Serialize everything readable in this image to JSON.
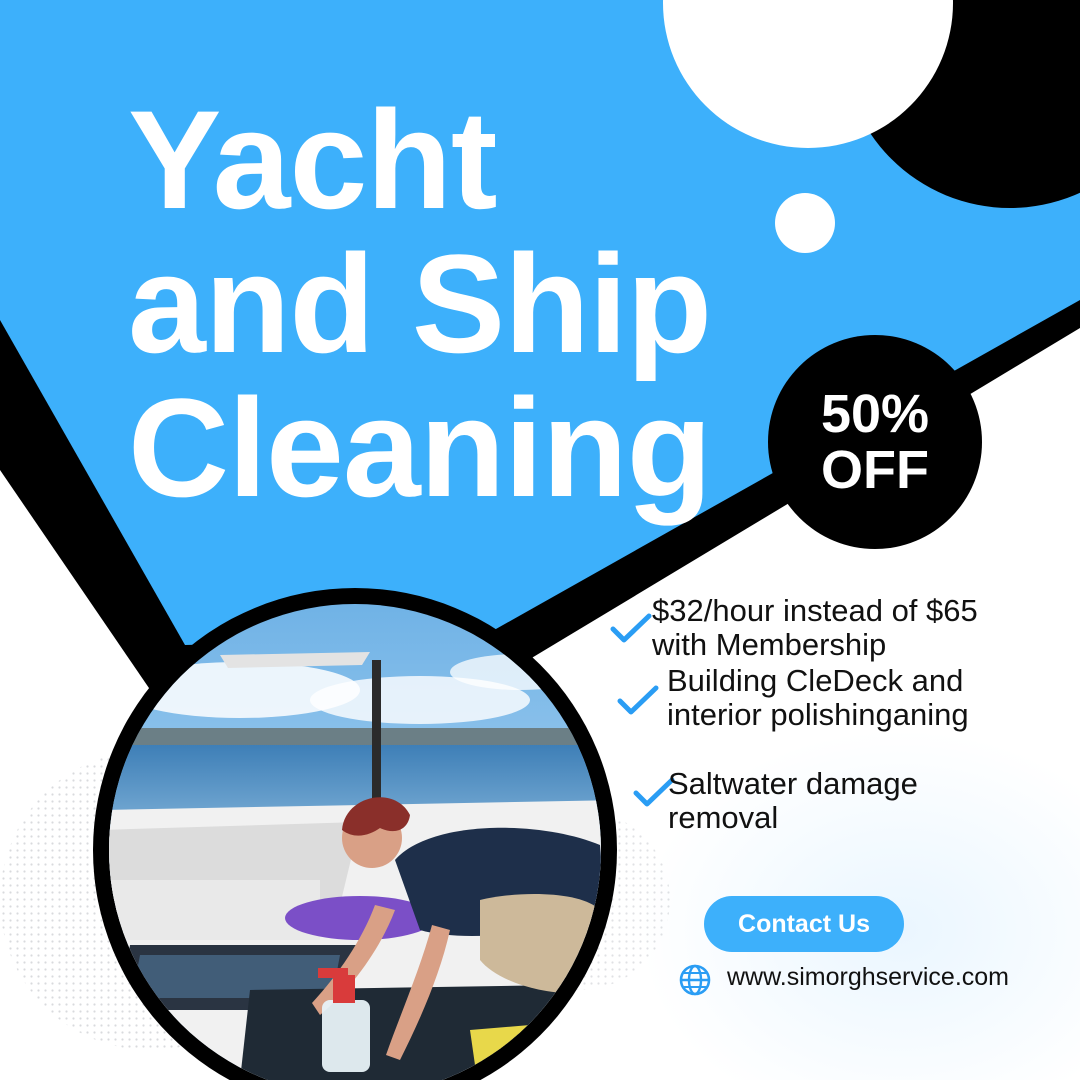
{
  "headline": {
    "line1": "Yacht",
    "line2": "and Ship",
    "line3": "Cleaning"
  },
  "badge": {
    "line1": "50%",
    "line2": "OFF"
  },
  "features": [
    {
      "line1": "$32/hour instead of $65",
      "line2": "with Membership"
    },
    {
      "line1": "Building CleDeck and",
      "line2": "interior polishinganing"
    },
    {
      "line1": "Saltwater damage",
      "line2": "removal"
    }
  ],
  "cta": {
    "label": "Contact Us"
  },
  "website": {
    "url": "www.simorghservice.com",
    "icon": "globe-icon"
  },
  "colors": {
    "brand_blue": "#3db0fb",
    "black": "#000000",
    "white": "#ffffff",
    "check_blue": "#2a9df4"
  }
}
